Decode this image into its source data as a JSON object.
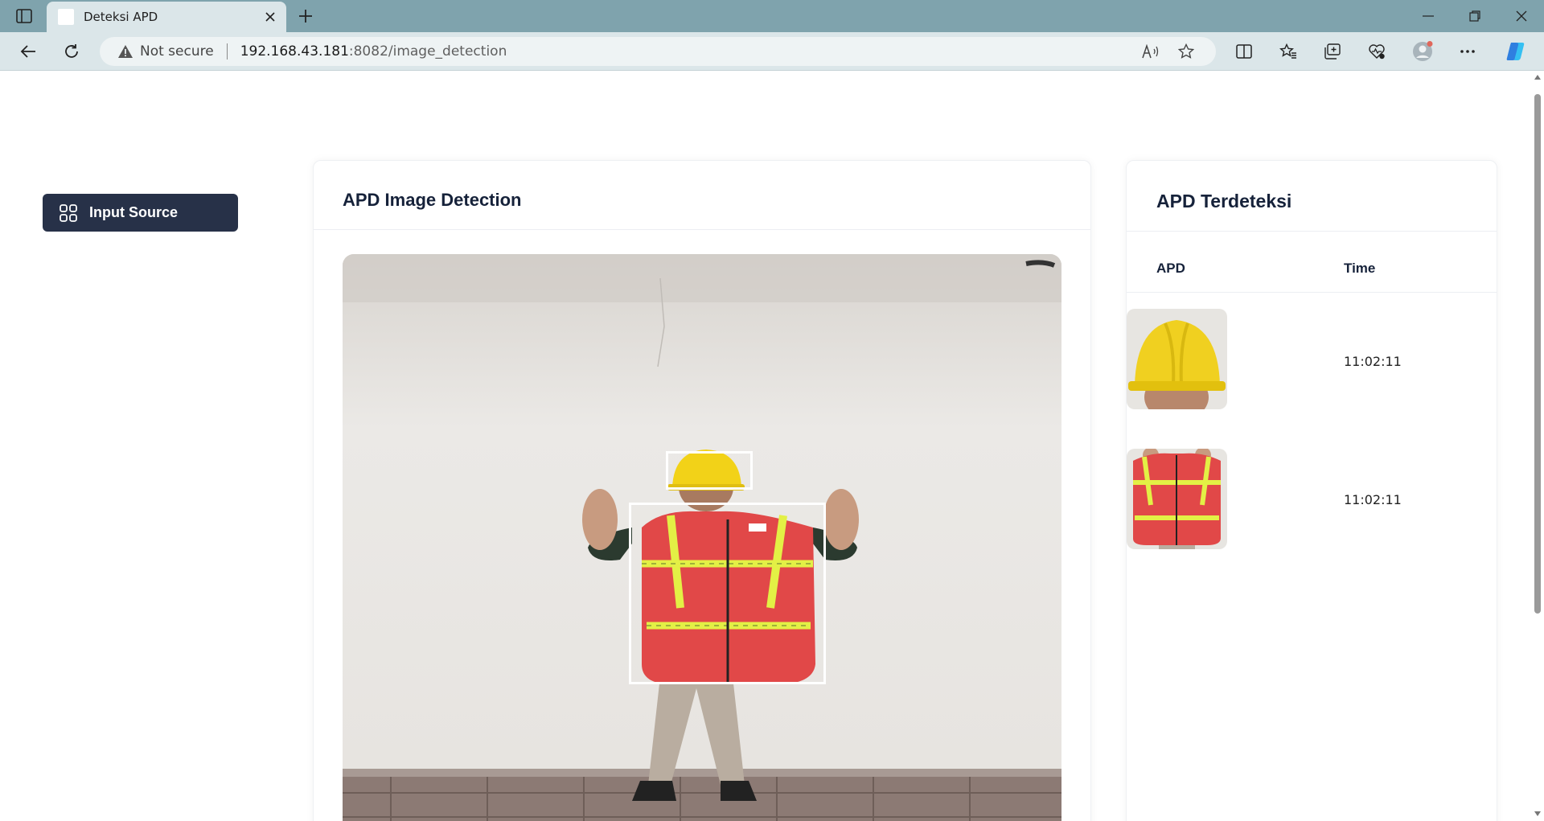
{
  "browser": {
    "tab_title": "Deteksi APD",
    "security_label": "Not secure",
    "url_host": "192.168.43.181",
    "url_path": ":8082/image_detection"
  },
  "sidebar": {
    "input_source_label": "Input Source"
  },
  "detection_card": {
    "title": "APD Image Detection"
  },
  "detected_card": {
    "title": "APD Terdeteksi",
    "columns": [
      "APD",
      "Time"
    ],
    "rows": [
      {
        "item": "helmet",
        "time": "11:02:11"
      },
      {
        "item": "vest",
        "time": "11:02:11"
      }
    ]
  },
  "icons": {
    "tab_sidebar": "sidebar-toggle-icon",
    "back": "back-arrow-icon",
    "refresh": "refresh-icon",
    "warning": "warning-icon",
    "read_aloud": "read-aloud-icon",
    "favorite": "star-icon",
    "split": "split-screen-icon",
    "favorites": "favorites-icon",
    "collections": "collections-icon",
    "health": "browser-essentials-icon",
    "profile": "profile-icon",
    "more": "more-icon",
    "copilot": "copilot-icon",
    "grid": "grid-icon"
  },
  "colors": {
    "tabbar": "#7fa3ad",
    "toolbar": "#dbe6e9",
    "button_dark": "#273148",
    "text_heading": "#16223a",
    "bbox": "#ffffff"
  }
}
